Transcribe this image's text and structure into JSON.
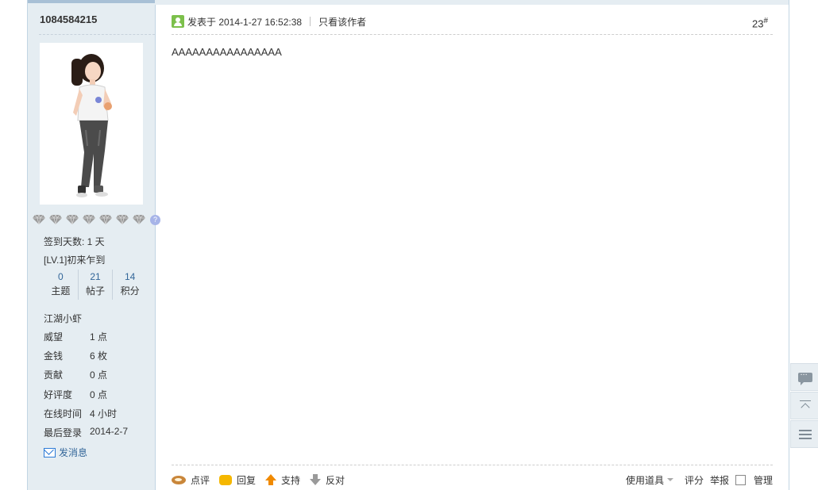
{
  "user": {
    "username": "1084584215",
    "signin_days": "签到天数: 1 天",
    "level": "[LV.1]初来乍到",
    "stats": [
      {
        "value": "0",
        "label": "主题"
      },
      {
        "value": "21",
        "label": "帖子"
      },
      {
        "value": "14",
        "label": "积分"
      }
    ],
    "group": "江湖小虾",
    "info": [
      {
        "key": "威望",
        "value": "1 点"
      },
      {
        "key": "金钱",
        "value": "6 枚"
      },
      {
        "key": "贡献",
        "value": "0 点"
      },
      {
        "key": "好评度",
        "value": "0 点"
      },
      {
        "key": "在线时间",
        "value": "4 小时"
      },
      {
        "key": "最后登录",
        "value": "2014-2-7"
      }
    ],
    "send_message": "发消息",
    "medal_count": 7,
    "medal_help": "?"
  },
  "post": {
    "posted_at": "发表于 2014-1-27 16:52:38",
    "only_author": "只看该作者",
    "floor": "23",
    "floor_mark": "#",
    "content": "AAAAAAAAAAAAAAAA"
  },
  "actions": {
    "comment": "点评",
    "reply": "回复",
    "support": "支持",
    "oppose": "反对",
    "tools": "使用道具",
    "rate": "评分",
    "report": "举报",
    "manage": "管理"
  }
}
